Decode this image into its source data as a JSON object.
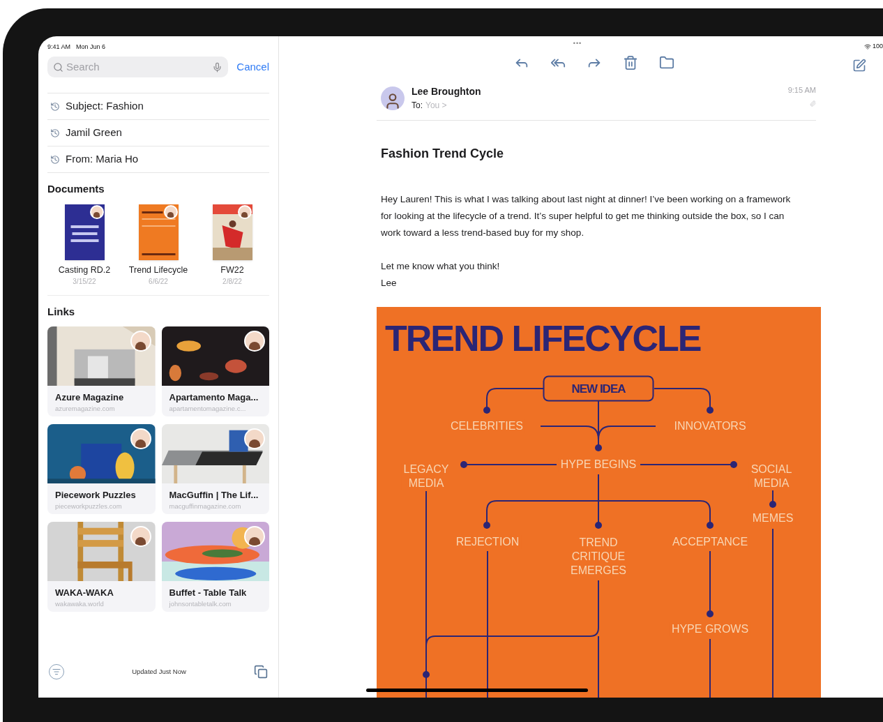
{
  "status_bar": {
    "time": "9:41 AM",
    "date": "Mon Jun 6",
    "multitasking": "•••",
    "battery": "100"
  },
  "sidebar": {
    "search": {
      "placeholder": "Search"
    },
    "cancel": "Cancel",
    "recent_searches": [
      "Subject: Fashion",
      "Jamil Green",
      "From: Maria Ho"
    ],
    "documents": {
      "heading": "Documents",
      "items": [
        {
          "title": "Casting RD.2",
          "date": "3/15/22"
        },
        {
          "title": "Trend Lifecycle",
          "date": "6/6/22"
        },
        {
          "title": "FW22",
          "date": "2/8/22"
        }
      ]
    },
    "links": {
      "heading": "Links",
      "items": [
        {
          "title": "Azure Magazine",
          "url": "azuremagazine.com"
        },
        {
          "title": "Apartamento Maga...",
          "url": "apartamentomagazine.c..."
        },
        {
          "title": "Piecework Puzzles",
          "url": "pieceworkpuzzles.com"
        },
        {
          "title": "MacGuffin | The Lif...",
          "url": "macguffinmagazine.com"
        },
        {
          "title": "WAKA-WAKA",
          "url": "wakawaka.world"
        },
        {
          "title": "Buffet - Table Talk",
          "url": "johnsontabletalk.com"
        }
      ]
    },
    "footer": {
      "status": "Updated Just Now"
    }
  },
  "message": {
    "sender": "Lee Broughton",
    "to_label": "To:",
    "recipient": "You >",
    "time": "9:15 AM",
    "subject": "Fashion Trend Cycle",
    "paragraphs": [
      "Hey Lauren! This is what I was talking about last night at dinner! I’ve been working on a framework for looking at the lifecycle of a trend. It’s super helpful to get me thinking outside the box, so I can work toward a less trend-based buy for my shop.",
      "Let me know what you think!\nLee"
    ]
  },
  "poster": {
    "title": "TREND LIFECYCLE",
    "nodes": [
      {
        "label": "NEW IDEA",
        "kind": "box"
      },
      {
        "label": "CELEBRITIES",
        "kind": "plain"
      },
      {
        "label": "INNOVATORS",
        "kind": "plain"
      },
      {
        "label": "HYPE BEGINS",
        "kind": "plain"
      },
      {
        "label": "LEGACY\nMEDIA",
        "kind": "plain"
      },
      {
        "label": "SOCIAL\nMEDIA",
        "kind": "plain"
      },
      {
        "label": "MEMES",
        "kind": "plain"
      },
      {
        "label": "REJECTION",
        "kind": "plain"
      },
      {
        "label": "TREND\nCRITIQUE\nEMERGES",
        "kind": "plain"
      },
      {
        "label": "ACCEPTANCE",
        "kind": "plain"
      },
      {
        "label": "HYPE GROWS",
        "kind": "plain"
      }
    ]
  }
}
